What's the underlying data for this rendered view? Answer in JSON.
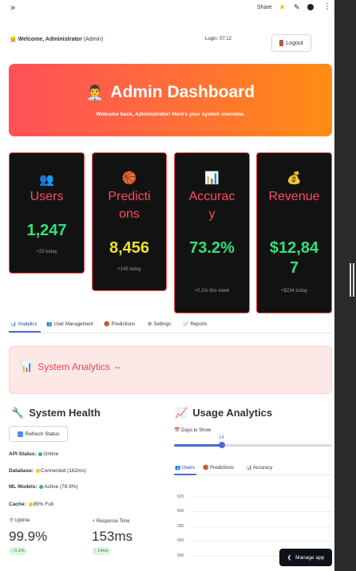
{
  "toolbar": {
    "sidebar_toggle": "»",
    "share_label": "Share",
    "star_icon": "★",
    "edit_icon": "✎",
    "menu_icon": "⋮"
  },
  "header": {
    "welcome_icon": "👷",
    "welcome_bold": "Welcome, Administrator",
    "welcome_role": "(Admin)",
    "login_time": "Login: 07:12",
    "logout_label": "Logout"
  },
  "hero": {
    "icon": "👨‍💼",
    "title": "Admin Dashboard",
    "subtitle": "Welcome back, Administrator! Here's your system overview."
  },
  "cards": [
    {
      "icon": "👥",
      "label": "Users",
      "value": "1,247",
      "sub": "+23 today"
    },
    {
      "icon": "🏀",
      "label_line1": "Predicti",
      "label_line2": "ons",
      "value": "8,456",
      "sub": "+145 today"
    },
    {
      "icon": "📊",
      "label_line1": "Accurac",
      "label_line2": "y",
      "value": "73.2%",
      "sub": "+2.1% this week"
    },
    {
      "icon": "💰",
      "label": "Revenue",
      "value_line1": "$12,84",
      "value_line2": "7",
      "sub": "+$234 today"
    }
  ],
  "tabs": [
    {
      "icon": "📊",
      "label": "Analytics"
    },
    {
      "icon": "👥",
      "label": "User Management"
    },
    {
      "icon": "🏀",
      "label": "Predictions"
    },
    {
      "icon": "⚙",
      "label": "Settings"
    },
    {
      "icon": "📈",
      "label": "Reports"
    }
  ],
  "analytics": {
    "icon": "📊",
    "title": "System Analytics",
    "link_icon": "⇔"
  },
  "health": {
    "icon": "🔧",
    "title": "System Health",
    "refresh_label": "Refresh Status",
    "api_label": "API Status:",
    "api_value": "Online",
    "db_label": "Database:",
    "db_value": "Connected (162ms)",
    "ml_label": "ML Models:",
    "ml_value": "Active (78.9%)",
    "cache_label": "Cache:",
    "cache_value": "85% Full",
    "uptime_icon": "⏱",
    "uptime_label": "Uptime",
    "uptime_value": "99.9%",
    "uptime_delta": "↑ 0.1%",
    "response_icon": "⚡",
    "response_label": "Response Time",
    "response_value": "153ms",
    "response_delta": "↑ 14ms",
    "colors": {
      "green": "#21c354",
      "yellow": "#f5c518"
    }
  },
  "usage": {
    "icon": "📈",
    "title": "Usage Analytics",
    "slider_icon": "📅",
    "slider_label": "Days to Show",
    "slider_value": "14",
    "slider_fraction": 0.31,
    "subtabs": [
      {
        "icon": "👥",
        "label": "Users"
      },
      {
        "icon": "🏀",
        "label": "Predictions"
      },
      {
        "icon": "📊",
        "label": "Accuracy"
      }
    ],
    "y_ticks": [
      "620",
      "600",
      "580",
      "560",
      "540"
    ]
  },
  "footer": {
    "manage_label": "Manage app",
    "manage_icon": "❮"
  },
  "colors": {
    "accent": "#ff4b5c",
    "primary": "#4a6cd4",
    "hero_start": "#ff4f5a",
    "hero_end": "#ff8c12",
    "card_bg": "#121212"
  }
}
